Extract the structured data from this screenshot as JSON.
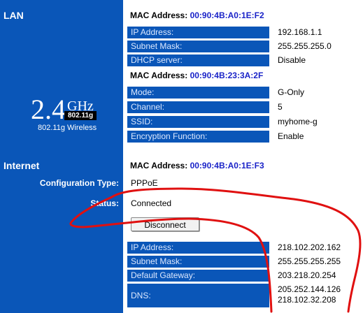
{
  "lan": {
    "title": "LAN",
    "mac_label": "MAC Address:",
    "mac": "00:90:4B:A0:1E:F2",
    "rows": [
      {
        "label": "IP Address:",
        "value": "192.168.1.1"
      },
      {
        "label": "Subnet Mask:",
        "value": "255.255.255.0"
      },
      {
        "label": "DHCP server:",
        "value": "Disable"
      }
    ]
  },
  "wireless": {
    "mac_label": "MAC Address:",
    "mac": "00:90:4B:23:3A:2F",
    "logo_big": "2.4",
    "logo_ghz": "GHz",
    "logo_pill": "802.11g",
    "caption": "802.11g Wireless",
    "rows": [
      {
        "label": "Mode:",
        "value": "G-Only"
      },
      {
        "label": "Channel:",
        "value": "5"
      },
      {
        "label": "SSID:",
        "value": "myhome-g"
      },
      {
        "label": "Encryption Function:",
        "value": "Enable"
      }
    ]
  },
  "internet": {
    "title": "Internet",
    "mac_label": "MAC Address:",
    "mac": "00:90:4B:A0:1E:F3",
    "config_label": "Configuration Type:",
    "config_value": "PPPoE",
    "status_label": "Status:",
    "status_value": "Connected",
    "disconnect_label": "Disconnect",
    "rows": [
      {
        "label": "IP Address:",
        "value": "218.102.202.162"
      },
      {
        "label": "Subnet Mask:",
        "value": "255.255.255.255"
      },
      {
        "label": "Default Gateway:",
        "value": "203.218.20.254"
      },
      {
        "label": "DNS:",
        "value": "205.252.144.126",
        "value2": "218.102.32.208"
      }
    ]
  },
  "colors": {
    "sidebar": "#0a56b8",
    "mac": "#1a23c8",
    "annotation": "#e01010"
  }
}
